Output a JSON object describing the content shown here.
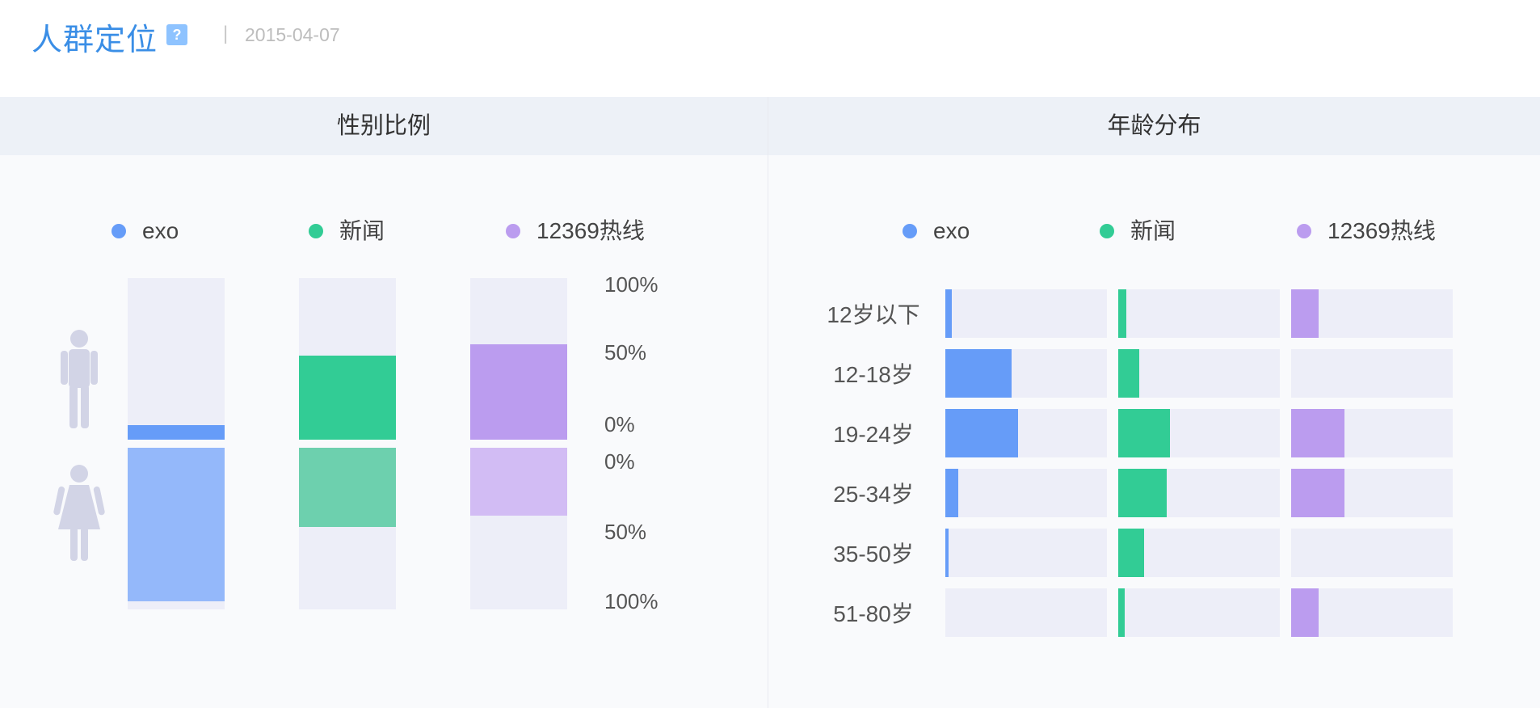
{
  "header": {
    "title": "人群定位",
    "help_glyph": "?",
    "separator": "|",
    "date": "2015-04-07"
  },
  "colors": {
    "exo": "#669cf8",
    "exo_light": "#94b8fa",
    "news": "#32cc95",
    "news_light": "#6dd0ae",
    "hotline": "#bb9cef",
    "hotline_light": "#d2bcf4",
    "track": "#edeef8"
  },
  "left_panel": {
    "title": "性别比例",
    "legend": [
      {
        "label": "exo",
        "color": "#669cf8"
      },
      {
        "label": "新闻",
        "color": "#32cc95"
      },
      {
        "label": "12369热线",
        "color": "#bb9cef"
      }
    ],
    "icons": [
      "male-icon",
      "female-icon"
    ]
  },
  "right_panel": {
    "title": "年龄分布",
    "legend": [
      {
        "label": "exo",
        "color": "#669cf8"
      },
      {
        "label": "新闻",
        "color": "#32cc95"
      },
      {
        "label": "12369热线",
        "color": "#bb9cef"
      }
    ]
  },
  "chart_data": [
    {
      "type": "bar",
      "orientation": "vertical-diverging",
      "title": "性别比例",
      "categories": [
        "exo",
        "新闻",
        "12369热线"
      ],
      "upper_tick_labels": [
        "100%",
        "50%",
        "0%"
      ],
      "lower_tick_labels": [
        "0%",
        "50%",
        "100%"
      ],
      "series": [
        {
          "name": "男",
          "values": [
            9,
            52,
            59
          ]
        },
        {
          "name": "女",
          "values": [
            95,
            49,
            42
          ]
        }
      ],
      "ylim": [
        0,
        100
      ]
    },
    {
      "type": "bar",
      "orientation": "horizontal",
      "title": "年龄分布",
      "categories": [
        "12岁以下",
        "12-18岁",
        "19-24岁",
        "25-34岁",
        "35-50岁",
        "51-80岁"
      ],
      "series": [
        {
          "name": "exo",
          "values": [
            4,
            41,
            45,
            8,
            2,
            0
          ]
        },
        {
          "name": "新闻",
          "values": [
            5,
            13,
            32,
            30,
            16,
            4
          ]
        },
        {
          "name": "12369热线",
          "values": [
            17,
            0,
            33,
            33,
            0,
            17
          ]
        }
      ],
      "xlim": [
        0,
        100
      ]
    }
  ]
}
